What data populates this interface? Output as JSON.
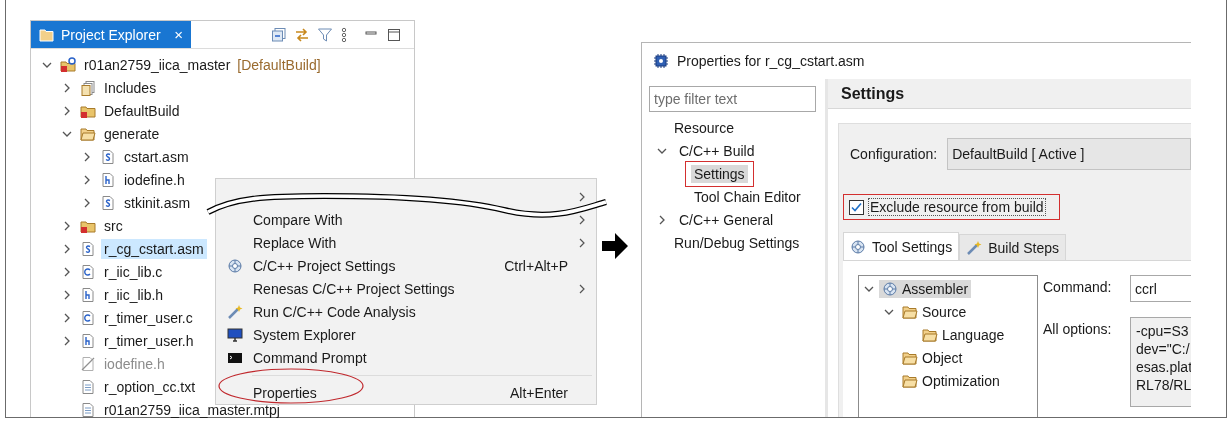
{
  "explorer": {
    "title": "Project Explorer",
    "close": "×",
    "tree": [
      {
        "label": "r01an2759_iica_master",
        "decoration": "[DefaultBuild]",
        "kind": "project",
        "expanded": true,
        "selected": false,
        "children": [
          {
            "label": "Includes",
            "kind": "includes",
            "expanded": false,
            "selected": false
          },
          {
            "label": "DefaultBuild",
            "kind": "error-folder",
            "expanded": false,
            "selected": false
          },
          {
            "label": "generate",
            "kind": "folder",
            "expanded": true,
            "selected": false,
            "children": [
              {
                "label": "cstart.asm",
                "kind": "asm-file",
                "expanded": false,
                "selected": false
              },
              {
                "label": "iodefine.h",
                "kind": "header-file",
                "expanded": false,
                "selected": false
              },
              {
                "label": "stkinit.asm",
                "kind": "asm-file",
                "expanded": false,
                "selected": false
              }
            ]
          },
          {
            "label": "src",
            "kind": "error-folder",
            "expanded": false,
            "selected": false
          },
          {
            "label": "r_cg_cstart.asm",
            "kind": "asm-file",
            "expanded": false,
            "selected": true
          },
          {
            "label": "r_iic_lib.c",
            "kind": "c-file",
            "expanded": false,
            "selected": false
          },
          {
            "label": "r_iic_lib.h",
            "kind": "header-file",
            "expanded": false,
            "selected": false
          },
          {
            "label": "r_timer_user.c",
            "kind": "c-file",
            "expanded": false,
            "selected": false
          },
          {
            "label": "r_timer_user.h",
            "kind": "header-file",
            "expanded": false,
            "selected": false
          },
          {
            "label": "iodefine.h",
            "kind": "excluded-file",
            "selected": false
          },
          {
            "label": "r_option_cc.txt",
            "kind": "text-file",
            "selected": false
          },
          {
            "label": "r01an2759_iica_master.mtpj",
            "kind": "text-file",
            "selected": false
          }
        ]
      }
    ]
  },
  "context_menu": {
    "items": [
      {
        "kind": "item",
        "submenu": true,
        "highlighted": false
      },
      {
        "kind": "item",
        "label": "Compare With",
        "submenu": true,
        "highlighted": false
      },
      {
        "kind": "item",
        "label": "Replace With",
        "submenu": true,
        "highlighted": false
      },
      {
        "kind": "item",
        "label": "C/C++ Project Settings",
        "shortcut": "Ctrl+Alt+P",
        "submenu": false,
        "highlighted": false
      },
      {
        "kind": "item",
        "label": "Renesas C/C++ Project Settings",
        "submenu": true,
        "highlighted": false
      },
      {
        "kind": "item",
        "label": "Run C/C++ Code Analysis",
        "submenu": false,
        "highlighted": false
      },
      {
        "kind": "item",
        "label": "System Explorer",
        "submenu": false,
        "highlighted": false
      },
      {
        "kind": "item",
        "label": "Command Prompt",
        "submenu": false,
        "highlighted": false
      },
      {
        "kind": "separator"
      },
      {
        "kind": "item",
        "label": "Properties",
        "shortcut": "Alt+Enter",
        "submenu": false,
        "highlighted": true
      }
    ]
  },
  "properties_dialog": {
    "title": "Properties for r_cg_cstart.asm",
    "filter": {
      "placeholder": "type filter text"
    },
    "nav": [
      {
        "label": "Resource",
        "selected": false,
        "highlighted": false
      },
      {
        "label": "C/C++ Build",
        "expanded": true,
        "selected": false,
        "highlighted": false,
        "children": [
          {
            "label": "Settings",
            "selected": true,
            "highlighted": true
          },
          {
            "label": "Tool Chain Editor",
            "selected": false,
            "highlighted": false
          }
        ]
      },
      {
        "label": "C/C++ General",
        "expanded": false,
        "selected": false,
        "highlighted": false
      },
      {
        "label": "Run/Debug Settings",
        "selected": false,
        "highlighted": false
      }
    ],
    "page_title": "Settings",
    "configuration": {
      "label": "Configuration:",
      "value": "DefaultBuild  [ Active ]"
    },
    "exclude": {
      "label": "Exclude resource from build",
      "checked": true,
      "highlighted": true
    },
    "tabs": [
      {
        "label": "Tool Settings",
        "selected": true
      },
      {
        "label": "Build Steps",
        "selected": false
      }
    ],
    "tool_tree": [
      {
        "label": "Assembler",
        "expanded": true,
        "selected": true,
        "children": [
          {
            "label": "Source",
            "expanded": true,
            "selected": false,
            "children": [
              {
                "label": "Language",
                "selected": false
              }
            ]
          },
          {
            "label": "Object",
            "selected": false
          },
          {
            "label": "Optimization",
            "selected": false
          }
        ]
      }
    ],
    "command": {
      "label": "Command:",
      "value": "ccrl"
    },
    "all_options": {
      "label": "All options:",
      "lines": [
        "-cpu=S3",
        "dev=\"C:/",
        "esas.plat",
        "RL78/RL"
      ]
    }
  }
}
